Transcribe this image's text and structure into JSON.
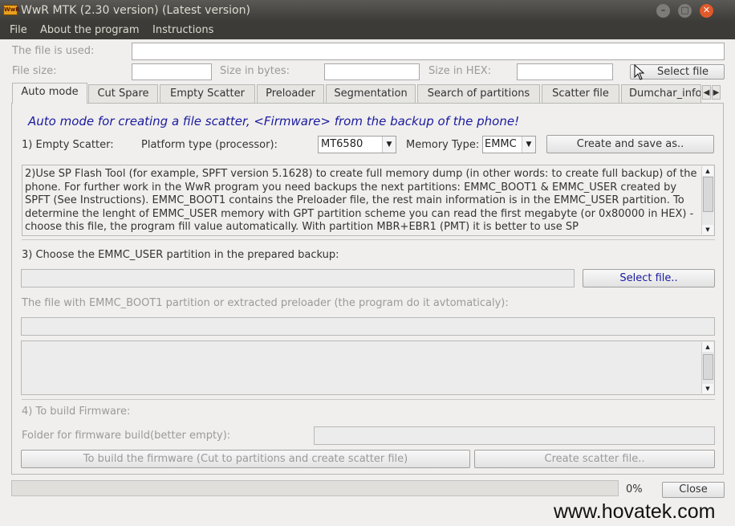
{
  "window": {
    "logo": "WwR",
    "title": "WwR MTK (2.30 version) (Latest version)",
    "minimize_glyph": "–",
    "maximize_glyph": "□",
    "close_glyph": "✕",
    "close_color": "#e05a2a",
    "button_color": "#7d7c78"
  },
  "menu": {
    "items": [
      "File",
      "About the program",
      "Instructions"
    ]
  },
  "file_info": {
    "file_used_label": "The file is used:",
    "file_size_label": "File size:",
    "size_bytes_label": "Size in bytes:",
    "size_hex_label": "Size in HEX:",
    "select_file_button": "Select file",
    "file_used_value": "",
    "file_size_value": "",
    "size_bytes_value": "",
    "size_hex_value": ""
  },
  "tabs": [
    "Auto mode",
    "Cut Spare",
    "Empty Scatter",
    "Preloader",
    "Segmentation",
    "Search of partitions",
    "Scatter file",
    "Dumchar_info"
  ],
  "tab_scroll": {
    "left": "◀",
    "right": "▶"
  },
  "auto_mode": {
    "heading": "Auto mode for creating a file scatter, <Firmware> from the backup of the phone!",
    "heading_color": "#1a1aa0",
    "step1_label": "1) Empty Scatter:",
    "platform_label": "Platform type (processor):",
    "platform_value": "MT6580",
    "memory_label": "Memory Type:",
    "memory_value": "EMMC",
    "create_save_button": "Create and save as..",
    "instructions_text": "2)Use SP Flash Tool (for example, SPFT version 5.1628) to create full memory dump (in other words: to create full backup) of the phone. For further work in the WwR program you need backups the next partitions: EMMC_BOOT1 & EMMC_USER created by SPFT (See Instructions). EMMC_BOOT1 contains the Preloader file, the rest main information is in the EMMC_USER partition. To determine the lenght of EMMC_USER memory with GPT partition scheme you can read the first megabyte (or 0x80000 in HEX) - choose this file, the program fill value automatically. With partition MBR+EBR1 (PMT) it is better to use SP",
    "step3_label": "3) Choose the EMMC_USER partition in the prepared backup:",
    "emmc_user_value": "",
    "select_file_button": "Select file..",
    "select_file_color": "#1a1aa0",
    "boot1_label": "The file with EMMC_BOOT1 partition or extracted preloader (the program do it avtomaticaly):",
    "boot1_value": "",
    "log_text": "",
    "step4_label": "4) To build Firmware:",
    "folder_label": "Folder for firmware build(better empty):",
    "folder_value": "",
    "build_button": "To build the firmware (Cut to partitions and create scatter file)",
    "create_scatter_button": "Create scatter file.."
  },
  "footer": {
    "progress_text": "0%",
    "progress": 0,
    "close_button": "Close"
  },
  "watermark": "www.hovatek.com",
  "icons": {
    "combo_arrow": "▼",
    "scroll_up": "▲",
    "scroll_down": "▼",
    "cursor": "arrow-cursor-icon"
  }
}
